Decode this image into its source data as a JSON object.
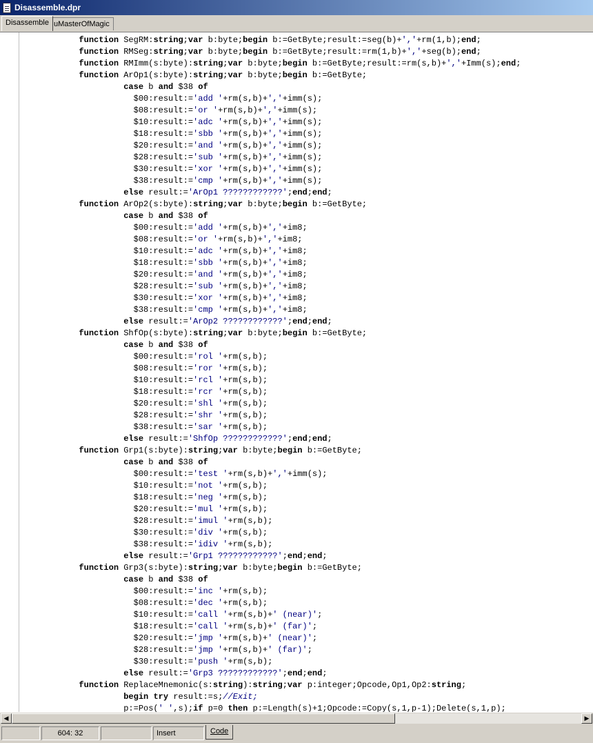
{
  "window": {
    "title": "Disassemble.dpr"
  },
  "tabs": [
    {
      "label": "Disassemble",
      "active": true
    },
    {
      "label": "uMasterOfMagic",
      "active": false
    }
  ],
  "code_lines": [
    [
      [
        "            ",
        "n"
      ],
      [
        "function",
        "k"
      ],
      [
        " SegRM:",
        "n"
      ],
      [
        "string",
        "k"
      ],
      [
        ";",
        "n"
      ],
      [
        "var",
        "k"
      ],
      [
        " b:byte;",
        "n"
      ],
      [
        "begin",
        "k"
      ],
      [
        " b:=GetByte;result:=seg(b)+",
        ""
      ],
      [
        "','",
        "s"
      ],
      [
        "+rm(1,b);",
        "n"
      ],
      [
        "end",
        "k"
      ],
      [
        ";",
        "n"
      ]
    ],
    [
      [
        "            ",
        "n"
      ],
      [
        "function",
        "k"
      ],
      [
        " RMSeg:",
        "n"
      ],
      [
        "string",
        "k"
      ],
      [
        ";",
        "n"
      ],
      [
        "var",
        "k"
      ],
      [
        " b:byte;",
        "n"
      ],
      [
        "begin",
        "k"
      ],
      [
        " b:=GetByte;result:=rm(1,b)+",
        "n"
      ],
      [
        "','",
        "s"
      ],
      [
        "+seg(b);",
        "n"
      ],
      [
        "end",
        "k"
      ],
      [
        ";",
        "n"
      ]
    ],
    [
      [
        "            ",
        "n"
      ],
      [
        "function",
        "k"
      ],
      [
        " RMImm(s:byte):",
        "n"
      ],
      [
        "string",
        "k"
      ],
      [
        ";",
        "n"
      ],
      [
        "var",
        "k"
      ],
      [
        " b:byte;",
        "n"
      ],
      [
        "begin",
        "k"
      ],
      [
        " b:=GetByte;result:=rm(s,b)+",
        "n"
      ],
      [
        "','",
        "s"
      ],
      [
        "+Imm(s);",
        "n"
      ],
      [
        "end",
        "k"
      ],
      [
        ";",
        "n"
      ]
    ],
    [
      [
        "            ",
        "n"
      ],
      [
        "function",
        "k"
      ],
      [
        " ArOp1(s:byte):",
        "n"
      ],
      [
        "string",
        "k"
      ],
      [
        ";",
        "n"
      ],
      [
        "var",
        "k"
      ],
      [
        " b:byte;",
        "n"
      ],
      [
        "begin",
        "k"
      ],
      [
        " b:=GetByte;",
        "n"
      ]
    ],
    [
      [
        "                     ",
        "n"
      ],
      [
        "case",
        "k"
      ],
      [
        " b ",
        "n"
      ],
      [
        "and",
        "k"
      ],
      [
        " $38 ",
        "n"
      ],
      [
        "of",
        "k"
      ]
    ],
    [
      [
        "                       $00:result:=",
        "n"
      ],
      [
        "'add '",
        "s"
      ],
      [
        "+rm(s,b)+",
        "n"
      ],
      [
        "','",
        "s"
      ],
      [
        "+imm(s);",
        "n"
      ]
    ],
    [
      [
        "                       $08:result:=",
        "n"
      ],
      [
        "'or '",
        "s"
      ],
      [
        "+rm(s,b)+",
        "n"
      ],
      [
        "','",
        "s"
      ],
      [
        "+imm(s);",
        "n"
      ]
    ],
    [
      [
        "                       $10:result:=",
        "n"
      ],
      [
        "'adc '",
        "s"
      ],
      [
        "+rm(s,b)+",
        "n"
      ],
      [
        "','",
        "s"
      ],
      [
        "+imm(s);",
        "n"
      ]
    ],
    [
      [
        "                       $18:result:=",
        "n"
      ],
      [
        "'sbb '",
        "s"
      ],
      [
        "+rm(s,b)+",
        "n"
      ],
      [
        "','",
        "s"
      ],
      [
        "+imm(s);",
        "n"
      ]
    ],
    [
      [
        "                       $20:result:=",
        "n"
      ],
      [
        "'and '",
        "s"
      ],
      [
        "+rm(s,b)+",
        "n"
      ],
      [
        "','",
        "s"
      ],
      [
        "+imm(s);",
        "n"
      ]
    ],
    [
      [
        "                       $28:result:=",
        "n"
      ],
      [
        "'sub '",
        "s"
      ],
      [
        "+rm(s,b)+",
        "n"
      ],
      [
        "','",
        "s"
      ],
      [
        "+imm(s);",
        "n"
      ]
    ],
    [
      [
        "                       $30:result:=",
        "n"
      ],
      [
        "'xor '",
        "s"
      ],
      [
        "+rm(s,b)+",
        "n"
      ],
      [
        "','",
        "s"
      ],
      [
        "+imm(s);",
        "n"
      ]
    ],
    [
      [
        "                       $38:result:=",
        "n"
      ],
      [
        "'cmp '",
        "s"
      ],
      [
        "+rm(s,b)+",
        "n"
      ],
      [
        "','",
        "s"
      ],
      [
        "+imm(s);",
        "n"
      ]
    ],
    [
      [
        "                     ",
        "n"
      ],
      [
        "else",
        "k"
      ],
      [
        " result:=",
        "n"
      ],
      [
        "'ArOp1 ????????????'",
        "s"
      ],
      [
        ";",
        "n"
      ],
      [
        "end",
        "k"
      ],
      [
        ";",
        "n"
      ],
      [
        "end",
        "k"
      ],
      [
        ";",
        "n"
      ]
    ],
    [
      [
        "            ",
        "n"
      ],
      [
        "function",
        "k"
      ],
      [
        " ArOp2(s:byte):",
        "n"
      ],
      [
        "string",
        "k"
      ],
      [
        ";",
        "n"
      ],
      [
        "var",
        "k"
      ],
      [
        " b:byte;",
        "n"
      ],
      [
        "begin",
        "k"
      ],
      [
        " b:=GetByte;",
        "n"
      ]
    ],
    [
      [
        "                     ",
        "n"
      ],
      [
        "case",
        "k"
      ],
      [
        " b ",
        "n"
      ],
      [
        "and",
        "k"
      ],
      [
        " $38 ",
        "n"
      ],
      [
        "of",
        "k"
      ]
    ],
    [
      [
        "                       $00:result:=",
        "n"
      ],
      [
        "'add '",
        "s"
      ],
      [
        "+rm(s,b)+",
        "n"
      ],
      [
        "','",
        "s"
      ],
      [
        "+im8;",
        "n"
      ]
    ],
    [
      [
        "                       $08:result:=",
        "n"
      ],
      [
        "'or '",
        "s"
      ],
      [
        "+rm(s,b)+",
        "n"
      ],
      [
        "','",
        "s"
      ],
      [
        "+im8;",
        "n"
      ]
    ],
    [
      [
        "                       $10:result:=",
        "n"
      ],
      [
        "'adc '",
        "s"
      ],
      [
        "+rm(s,b)+",
        "n"
      ],
      [
        "','",
        "s"
      ],
      [
        "+im8;",
        "n"
      ]
    ],
    [
      [
        "                       $18:result:=",
        "n"
      ],
      [
        "'sbb '",
        "s"
      ],
      [
        "+rm(s,b)+",
        "n"
      ],
      [
        "','",
        "s"
      ],
      [
        "+im8;",
        "n"
      ]
    ],
    [
      [
        "                       $20:result:=",
        "n"
      ],
      [
        "'and '",
        "s"
      ],
      [
        "+rm(s,b)+",
        "n"
      ],
      [
        "','",
        "s"
      ],
      [
        "+im8;",
        "n"
      ]
    ],
    [
      [
        "                       $28:result:=",
        "n"
      ],
      [
        "'sub '",
        "s"
      ],
      [
        "+rm(s,b)+",
        "n"
      ],
      [
        "','",
        "s"
      ],
      [
        "+im8;",
        "n"
      ]
    ],
    [
      [
        "                       $30:result:=",
        "n"
      ],
      [
        "'xor '",
        "s"
      ],
      [
        "+rm(s,b)+",
        "n"
      ],
      [
        "','",
        "s"
      ],
      [
        "+im8;",
        "n"
      ]
    ],
    [
      [
        "                       $38:result:=",
        "n"
      ],
      [
        "'cmp '",
        "s"
      ],
      [
        "+rm(s,b)+",
        "n"
      ],
      [
        "','",
        "s"
      ],
      [
        "+im8;",
        "n"
      ]
    ],
    [
      [
        "                     ",
        "n"
      ],
      [
        "else",
        "k"
      ],
      [
        " result:=",
        "n"
      ],
      [
        "'ArOp2 ????????????'",
        "s"
      ],
      [
        ";",
        "n"
      ],
      [
        "end",
        "k"
      ],
      [
        ";",
        "n"
      ],
      [
        "end",
        "k"
      ],
      [
        ";",
        "n"
      ]
    ],
    [
      [
        "            ",
        "n"
      ],
      [
        "function",
        "k"
      ],
      [
        " ShfOp(s:byte):",
        "n"
      ],
      [
        "string",
        "k"
      ],
      [
        ";",
        "n"
      ],
      [
        "var",
        "k"
      ],
      [
        " b:byte;",
        "n"
      ],
      [
        "begin",
        "k"
      ],
      [
        " b:=GetByte;",
        "n"
      ]
    ],
    [
      [
        "                     ",
        "n"
      ],
      [
        "case",
        "k"
      ],
      [
        " b ",
        "n"
      ],
      [
        "and",
        "k"
      ],
      [
        " $38 ",
        "n"
      ],
      [
        "of",
        "k"
      ]
    ],
    [
      [
        "                       $00:result:=",
        "n"
      ],
      [
        "'rol '",
        "s"
      ],
      [
        "+rm(s,b);",
        "n"
      ]
    ],
    [
      [
        "                       $08:result:=",
        "n"
      ],
      [
        "'ror '",
        "s"
      ],
      [
        "+rm(s,b);",
        "n"
      ]
    ],
    [
      [
        "                       $10:result:=",
        "n"
      ],
      [
        "'rcl '",
        "s"
      ],
      [
        "+rm(s,b);",
        "n"
      ]
    ],
    [
      [
        "                       $18:result:=",
        "n"
      ],
      [
        "'rcr '",
        "s"
      ],
      [
        "+rm(s,b);",
        "n"
      ]
    ],
    [
      [
        "                       $20:result:=",
        "n"
      ],
      [
        "'shl '",
        "s"
      ],
      [
        "+rm(s,b);",
        "n"
      ]
    ],
    [
      [
        "                       $28:result:=",
        "n"
      ],
      [
        "'shr '",
        "s"
      ],
      [
        "+rm(s,b);",
        "n"
      ]
    ],
    [
      [
        "                       $38:result:=",
        "n"
      ],
      [
        "'sar '",
        "s"
      ],
      [
        "+rm(s,b);",
        "n"
      ]
    ],
    [
      [
        "                     ",
        "n"
      ],
      [
        "else",
        "k"
      ],
      [
        " result:=",
        "n"
      ],
      [
        "'ShfOp ????????????'",
        "s"
      ],
      [
        ";",
        "n"
      ],
      [
        "end",
        "k"
      ],
      [
        ";",
        "n"
      ],
      [
        "end",
        "k"
      ],
      [
        ";",
        "n"
      ]
    ],
    [
      [
        "            ",
        "n"
      ],
      [
        "function",
        "k"
      ],
      [
        " Grp1(s:byte):",
        "n"
      ],
      [
        "string",
        "k"
      ],
      [
        ";",
        "n"
      ],
      [
        "var",
        "k"
      ],
      [
        " b:byte;",
        "n"
      ],
      [
        "begin",
        "k"
      ],
      [
        " b:=GetByte;",
        "n"
      ]
    ],
    [
      [
        "                     ",
        "n"
      ],
      [
        "case",
        "k"
      ],
      [
        " b ",
        "n"
      ],
      [
        "and",
        "k"
      ],
      [
        " $38 ",
        "n"
      ],
      [
        "of",
        "k"
      ]
    ],
    [
      [
        "                       $00:result:=",
        "n"
      ],
      [
        "'test '",
        "s"
      ],
      [
        "+rm(s,b)+",
        "n"
      ],
      [
        "','",
        "s"
      ],
      [
        "+imm(s);",
        "n"
      ]
    ],
    [
      [
        "                       $10:result:=",
        "n"
      ],
      [
        "'not '",
        "s"
      ],
      [
        "+rm(s,b);",
        "n"
      ]
    ],
    [
      [
        "                       $18:result:=",
        "n"
      ],
      [
        "'neg '",
        "s"
      ],
      [
        "+rm(s,b);",
        "n"
      ]
    ],
    [
      [
        "                       $20:result:=",
        "n"
      ],
      [
        "'mul '",
        "s"
      ],
      [
        "+rm(s,b);",
        "n"
      ]
    ],
    [
      [
        "                       $28:result:=",
        "n"
      ],
      [
        "'imul '",
        "s"
      ],
      [
        "+rm(s,b);",
        "n"
      ]
    ],
    [
      [
        "                       $30:result:=",
        "n"
      ],
      [
        "'div '",
        "s"
      ],
      [
        "+rm(s,b);",
        "n"
      ]
    ],
    [
      [
        "                       $38:result:=",
        "n"
      ],
      [
        "'idiv '",
        "s"
      ],
      [
        "+rm(s,b);",
        "n"
      ]
    ],
    [
      [
        "                     ",
        "n"
      ],
      [
        "else",
        "k"
      ],
      [
        " result:=",
        "n"
      ],
      [
        "'Grp1 ????????????'",
        "s"
      ],
      [
        ";",
        "n"
      ],
      [
        "end",
        "k"
      ],
      [
        ";",
        "n"
      ],
      [
        "end",
        "k"
      ],
      [
        ";",
        "n"
      ]
    ],
    [
      [
        "            ",
        "n"
      ],
      [
        "function",
        "k"
      ],
      [
        " Grp3(s:byte):",
        "n"
      ],
      [
        "string",
        "k"
      ],
      [
        ";",
        "n"
      ],
      [
        "var",
        "k"
      ],
      [
        " b:byte;",
        "n"
      ],
      [
        "begin",
        "k"
      ],
      [
        " b:=GetByte;",
        "n"
      ]
    ],
    [
      [
        "                     ",
        "n"
      ],
      [
        "case",
        "k"
      ],
      [
        " b ",
        "n"
      ],
      [
        "and",
        "k"
      ],
      [
        " $38 ",
        "n"
      ],
      [
        "of",
        "k"
      ]
    ],
    [
      [
        "                       $00:result:=",
        "n"
      ],
      [
        "'inc '",
        "s"
      ],
      [
        "+rm(s,b);",
        "n"
      ]
    ],
    [
      [
        "                       $08:result:=",
        "n"
      ],
      [
        "'dec '",
        "s"
      ],
      [
        "+rm(s,b);",
        "n"
      ]
    ],
    [
      [
        "                       $10:result:=",
        "n"
      ],
      [
        "'call '",
        "s"
      ],
      [
        "+rm(s,b)+",
        "n"
      ],
      [
        "' (near)'",
        "s"
      ],
      [
        ";",
        "n"
      ]
    ],
    [
      [
        "                       $18:result:=",
        "n"
      ],
      [
        "'call '",
        "s"
      ],
      [
        "+rm(s,b)+",
        "n"
      ],
      [
        "' (far)'",
        "s"
      ],
      [
        ";",
        "n"
      ]
    ],
    [
      [
        "                       $20:result:=",
        "n"
      ],
      [
        "'jmp '",
        "s"
      ],
      [
        "+rm(s,b)+",
        "n"
      ],
      [
        "' (near)'",
        "s"
      ],
      [
        ";",
        "n"
      ]
    ],
    [
      [
        "                       $28:result:=",
        "n"
      ],
      [
        "'jmp '",
        "s"
      ],
      [
        "+rm(s,b)+",
        "n"
      ],
      [
        "' (far)'",
        "s"
      ],
      [
        ";",
        "n"
      ]
    ],
    [
      [
        "                       $30:result:=",
        "n"
      ],
      [
        "'push '",
        "s"
      ],
      [
        "+rm(s,b);",
        "n"
      ]
    ],
    [
      [
        "                     ",
        "n"
      ],
      [
        "else",
        "k"
      ],
      [
        " result:=",
        "n"
      ],
      [
        "'Grp3 ????????????'",
        "s"
      ],
      [
        ";",
        "n"
      ],
      [
        "end",
        "k"
      ],
      [
        ";",
        "n"
      ],
      [
        "end",
        "k"
      ],
      [
        ";",
        "n"
      ]
    ],
    [
      [
        "            ",
        "n"
      ],
      [
        "function",
        "k"
      ],
      [
        " ReplaceMnemonic(s:",
        "n"
      ],
      [
        "string",
        "k"
      ],
      [
        "):",
        "n"
      ],
      [
        "string",
        "k"
      ],
      [
        ";",
        "n"
      ],
      [
        "var",
        "k"
      ],
      [
        " p:integer;Opcode,Op1,Op2:",
        "n"
      ],
      [
        "string",
        "k"
      ],
      [
        ";",
        "n"
      ]
    ],
    [
      [
        "                     ",
        "n"
      ],
      [
        "begin",
        "k"
      ],
      [
        " ",
        "n"
      ],
      [
        "try",
        "k"
      ],
      [
        " result:=s;",
        "n"
      ],
      [
        "//Exit;",
        "c"
      ]
    ],
    [
      [
        "                     p:=Pos(",
        "n"
      ],
      [
        "' '",
        "s"
      ],
      [
        ",s);",
        "n"
      ],
      [
        "if",
        "k"
      ],
      [
        " p=0 ",
        "n"
      ],
      [
        "then",
        "k"
      ],
      [
        " p:=Length(s)+1;Opcode:=Copy(s,1,p-1);Delete(s,1,p);",
        "n"
      ]
    ]
  ],
  "statusbar": {
    "position": "604: 32",
    "mode": "Insert",
    "view_tab": "Code"
  },
  "colors": {
    "title_start": "#0a246a",
    "title_end": "#a6caf0",
    "string": "#000080",
    "face": "#d4d0c8"
  }
}
